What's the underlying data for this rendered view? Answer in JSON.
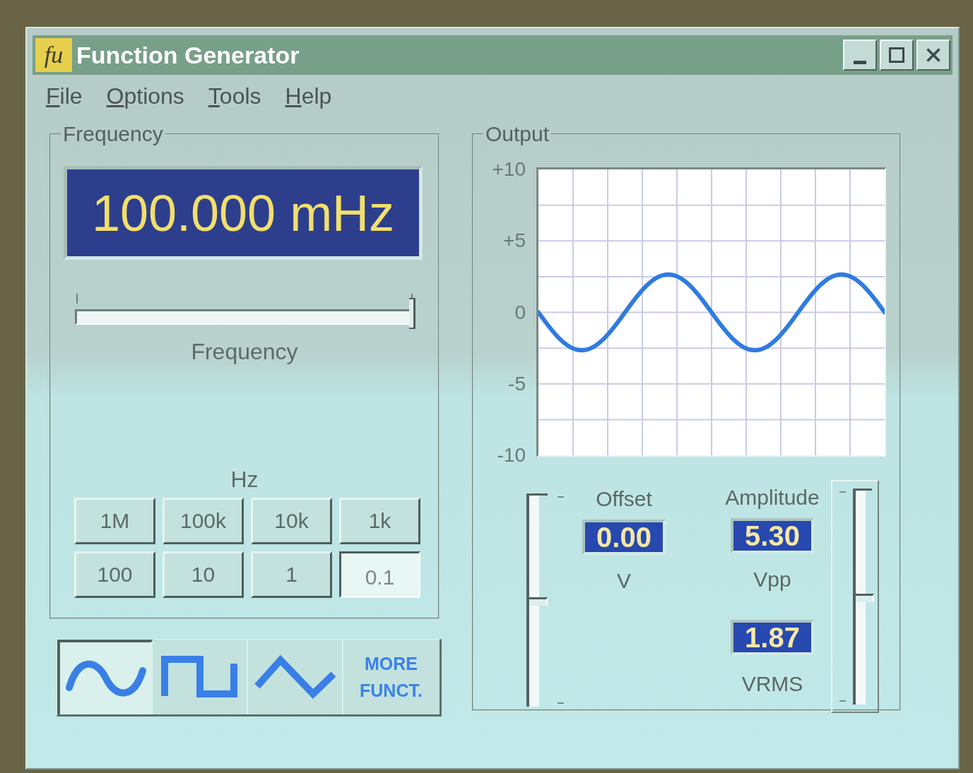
{
  "window": {
    "title": "Function Generator",
    "icon_text": "fu"
  },
  "menu": [
    {
      "label": "File"
    },
    {
      "label": "Options"
    },
    {
      "label": "Tools"
    },
    {
      "label": "Help"
    }
  ],
  "frequency": {
    "title": "Frequency",
    "display": "100.000 mHz",
    "slider": {
      "label": "Frequency",
      "level": 1
    },
    "unit": "Hz",
    "range_buttons": [
      {
        "label": "1M",
        "selected": false
      },
      {
        "label": "100k",
        "selected": false
      },
      {
        "label": "10k",
        "selected": false
      },
      {
        "label": "1k",
        "selected": false
      },
      {
        "label": "100",
        "selected": false
      },
      {
        "label": "10",
        "selected": false
      },
      {
        "label": "1",
        "selected": false
      },
      {
        "label": "0.1",
        "selected": true
      }
    ]
  },
  "waveforms": [
    {
      "kind": "sine",
      "selected": true
    },
    {
      "kind": "square",
      "selected": false
    },
    {
      "kind": "triangle",
      "selected": false
    },
    {
      "kind": "more",
      "label": "MORE FUNCT.",
      "selected": false
    }
  ],
  "output": {
    "title": "Output",
    "y_ticks": [
      "+10",
      "+5",
      "0",
      "-5",
      "-10"
    ],
    "offset": {
      "label": "Offset",
      "value": "0.00",
      "unit": "V",
      "level": 0.5
    },
    "amplitude": {
      "label": "Amplitude",
      "value": "5.30",
      "unit": "Vpp",
      "rms_value": "1.87",
      "rms_unit": "VRMS",
      "level": 0.5
    }
  }
}
